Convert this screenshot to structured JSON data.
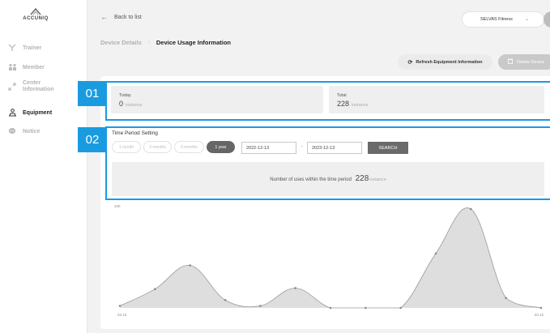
{
  "brand": {
    "name": "ACCUNIQ"
  },
  "sidebar": {
    "items": [
      {
        "label": "Trainer",
        "icon": "whistle-icon"
      },
      {
        "label": "Member",
        "icon": "members-icon"
      },
      {
        "label": "Center",
        "label2": "Information",
        "icon": "link-icon"
      },
      {
        "label": "Equipment",
        "icon": "scale-icon"
      },
      {
        "label": "Notice",
        "icon": "chat-icon"
      }
    ]
  },
  "topbar": {
    "back_label": "Back to list",
    "gym_select": "SELVAS Fitness"
  },
  "breadcrumb": {
    "parent": "Device Details",
    "current": "Device Usage Information"
  },
  "actions": {
    "refresh_label": "Refresh Equipment Information",
    "delete_label": "Delete Device"
  },
  "annotations": {
    "one": "01",
    "two": "02"
  },
  "stats": {
    "today_label": "Today",
    "today_value": "0",
    "today_unit": "instance",
    "total_label": "Total",
    "total_value": "228",
    "total_unit": "instance"
  },
  "period": {
    "title": "Time Period Setting",
    "chips": [
      "1 month",
      "3 months",
      "6 months",
      "1 year"
    ],
    "active_chip": "1 year",
    "start_date": "2022-12-13",
    "separator": "-",
    "end_date": "2023-12-13",
    "search_label": "SEARCH",
    "uses_label": "Number of uses within the time period",
    "uses_value": "228",
    "uses_unit": "instance"
  },
  "chart_data": {
    "type": "area",
    "x": [
      0,
      1,
      2,
      3,
      4,
      5,
      6,
      7,
      8,
      9,
      10,
      11,
      12
    ],
    "values": [
      2,
      19,
      43,
      8,
      2,
      20,
      0,
      0,
      0,
      55,
      100,
      10,
      0
    ],
    "ytick_top": "100",
    "xtick_start": "22.12",
    "xtick_end": "23.12",
    "ylim": [
      0,
      100
    ],
    "colors": {
      "fill": "#dedede",
      "line": "#9a9a9a",
      "point": "#8a8a8a"
    }
  }
}
